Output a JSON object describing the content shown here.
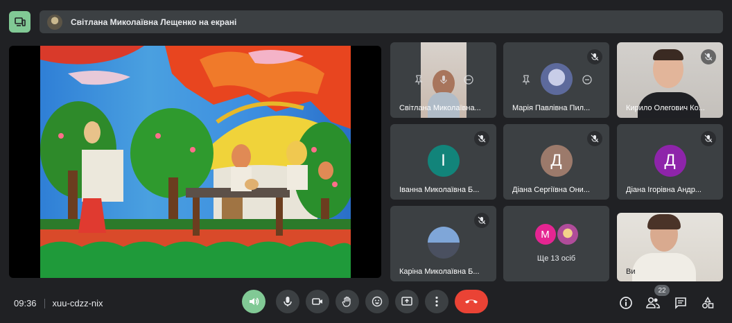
{
  "presentation": {
    "banner": "Світлана Миколаївна Лещенко на екрані"
  },
  "tiles": [
    {
      "name": "Світлана Миколаївна..."
    },
    {
      "name": "Марія Павлівна Пил..."
    },
    {
      "name": "Кирило Олегович Ко..."
    },
    {
      "name": "Іванна Миколаївна Б...",
      "initial": "І",
      "color": "#12847a"
    },
    {
      "name": "Діана Сергіївна Они...",
      "initial": "Д",
      "color": "#9c7a6b"
    },
    {
      "name": "Діана Ігорівна Андр...",
      "initial": "Д",
      "color": "#8e24aa"
    },
    {
      "name": "Каріна Миколаївна Б..."
    },
    {
      "more_initial": "М",
      "more_label": "Ще 13 осіб"
    },
    {
      "name": "Ви"
    }
  ],
  "meeting": {
    "time": "09:36",
    "code": "xuu-cdzz-nix",
    "participants_count": "22"
  },
  "colors": {
    "background": "#202124",
    "tile": "#3c4043",
    "accent_green": "#81c995",
    "hangup_red": "#ea4335"
  }
}
